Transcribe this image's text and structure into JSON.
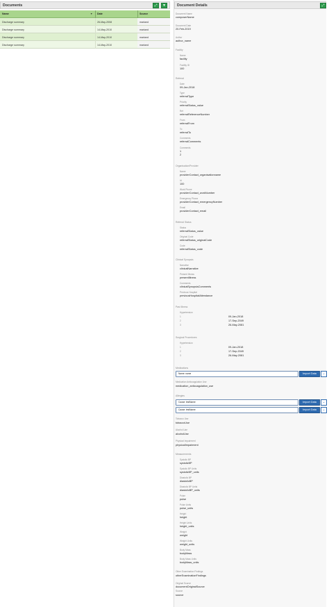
{
  "documents": {
    "title": "Documents",
    "expand_icon": "expand-icon",
    "filter_icon": "filter-icon",
    "columns": {
      "name": "Name",
      "date": "Date",
      "source": "Source"
    },
    "rows": [
      {
        "name": "Discharge summary",
        "date": "26-May-2008",
        "source": "mariand"
      },
      {
        "name": "Discharge summary",
        "date": "14-May-2010",
        "source": "mariand"
      },
      {
        "name": "Discharge summary",
        "date": "14-May-2010",
        "source": "mariand"
      },
      {
        "name": "Discharge summary",
        "date": "14-May-2010",
        "source": "mariand"
      }
    ]
  },
  "details": {
    "title": "Document Details",
    "expand_icon": "expand-icon",
    "document_name": {
      "label": "Document Name",
      "value": "composerName"
    },
    "document_date": {
      "label": "Document Date",
      "value": "20-Feb-2019"
    },
    "author": {
      "label": "Author",
      "value": "author_name"
    },
    "facility": {
      "title": "Facility",
      "name": {
        "label": "Name",
        "value": "facility"
      },
      "facility_id": {
        "label": "Facility ID",
        "value": "100"
      }
    },
    "referral": {
      "title": "Referral",
      "date": {
        "label": "Date",
        "value": "09-Jan-2018"
      },
      "type": {
        "label": "Type",
        "value": "referralType"
      },
      "priority": {
        "label": "Priority",
        "value": "referralStatus_value"
      },
      "ref": {
        "label": "Ref",
        "value": "referralReferenceNumber"
      },
      "from": {
        "label": "From",
        "value": "referralFrom"
      },
      "to": {
        "label": "To",
        "value": "referralTo"
      },
      "comments": {
        "label": "Comments",
        "value": "referralComments"
      },
      "comments2": {
        "label": "Comments",
        "value1": "1",
        "value2": "2"
      }
    },
    "organisation": {
      "title": "Organisation/Provider",
      "name": {
        "label": "Name",
        "value": "providerContact_organisationname"
      },
      "id": {
        "label": "Id",
        "value": "100"
      },
      "work_phone": {
        "label": "Work Phone",
        "value": "providerContact_workNumber"
      },
      "emergency_phone": {
        "label": "Emergency Phone",
        "value": "providerContact_emergencyNumber"
      },
      "email": {
        "label": "Email",
        "value": "providerContact_email"
      }
    },
    "referral_status": {
      "title": "Referral Status",
      "status": {
        "label": "Status",
        "value": "referralStatus_value"
      },
      "original_code": {
        "label": "Original Code",
        "value": "referralStatus_originalCode"
      },
      "code": {
        "label": "Code",
        "value": "referralStatus_code"
      }
    },
    "clinical_synopsis": {
      "title": "Clinical Synopsis",
      "narrative": {
        "label": "Narrative",
        "value": "clinicalNarrative"
      },
      "present_illness": {
        "label": "Present Illness",
        "value": "presentIllness"
      },
      "comments": {
        "label": "Comments",
        "value": "clinicalSynopsisComments"
      },
      "previous_hospital": {
        "label": "Previous Hospital",
        "value": "previousHospitalAttendance"
      }
    },
    "past_illness": {
      "title": "Past Illness",
      "label": "Hypertension",
      "rows": [
        {
          "n": "1",
          "date": "09-Jan-2018"
        },
        {
          "n": "2",
          "date": "17-Sep-2049"
        },
        {
          "n": "3",
          "date": "26-May-2081"
        }
      ]
    },
    "surgical_procedures": {
      "title": "Surgical Procedures",
      "label": "Hypertension",
      "rows": [
        {
          "n": "1",
          "date": "09-Jan-2018"
        },
        {
          "n": "2",
          "date": "17-Sep-2049"
        },
        {
          "n": "3",
          "date": "26-May-2081"
        }
      ]
    },
    "medications": {
      "title": "Medications",
      "field": "Name: name",
      "button": "Import Data"
    },
    "anticoagulation": {
      "label": "Medication Anticoagulation Use",
      "value": "medication_anticoagulation_use"
    },
    "allergies": {
      "title": "Allergies",
      "items": [
        {
          "field": "Cause: testName",
          "button": "Import Data"
        },
        {
          "field": "Cause: testName",
          "button": "Import Data"
        }
      ]
    },
    "tobacco": {
      "label": "Tobacco Use",
      "value": "tobaccoUse"
    },
    "alcohol": {
      "label": "Alcohol Use",
      "value": "alcoholUse"
    },
    "physical": {
      "label": "Physical Impairment",
      "value": "physicalImpairment"
    },
    "measurements": {
      "title": "Measurements",
      "items": [
        {
          "label": "Systolic BP",
          "value": "systolicBP"
        },
        {
          "label": "Systolic BP Units",
          "value": "systolicBP_units"
        },
        {
          "label": "Diastolic BP",
          "value": "diastolicBP"
        },
        {
          "label": "Diastolic BP Units",
          "value": "diastolicBP_units"
        },
        {
          "label": "Pulse",
          "value": "pulse"
        },
        {
          "label": "Pulse Units",
          "value": "pulse_units"
        },
        {
          "label": "Height",
          "value": "height"
        },
        {
          "label": "Height Units",
          "value": "height_units"
        },
        {
          "label": "Weight",
          "value": "weight"
        },
        {
          "label": "Weight Units",
          "value": "weight_units"
        },
        {
          "label": "Body Mass",
          "value": "bodyMass"
        },
        {
          "label": "Body Mass Units",
          "value": "bodyMass_units"
        }
      ]
    },
    "other_exam": {
      "label": "Other Examination Findings",
      "value": "otherExaminationFindings"
    },
    "original_source": {
      "label": "Original Source",
      "value": "documentOriginalSource"
    },
    "source": {
      "label": "Source",
      "value": "source"
    }
  }
}
